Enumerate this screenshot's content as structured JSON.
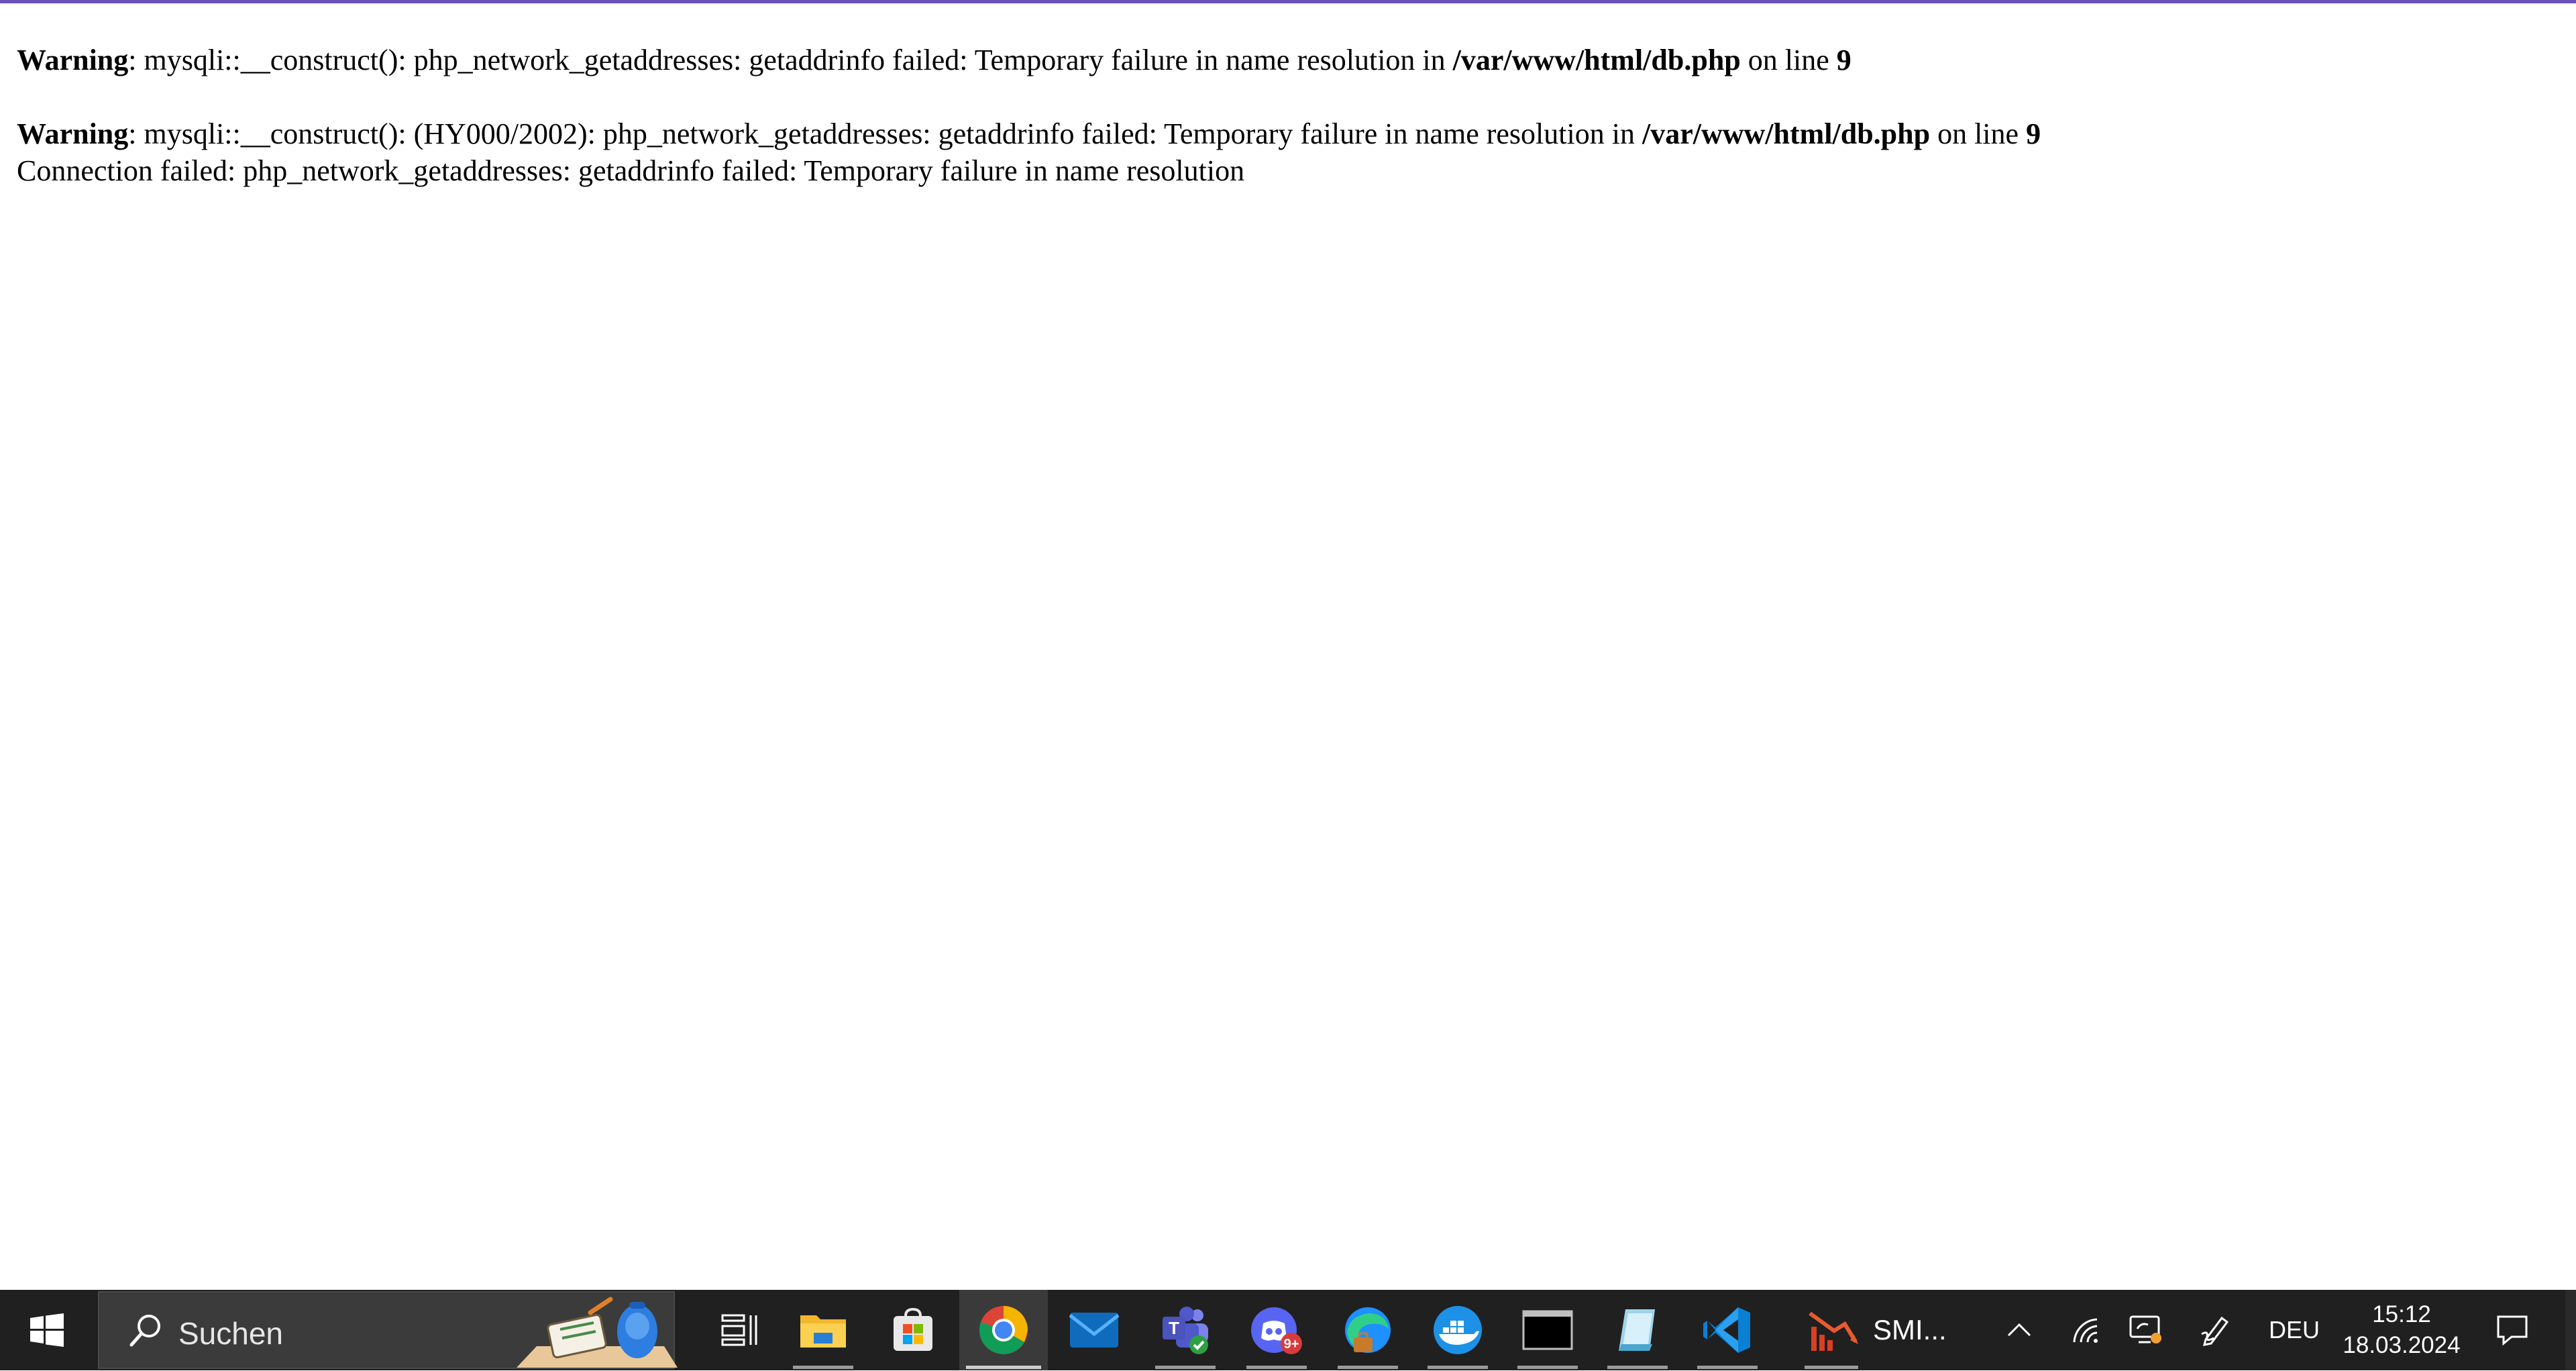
{
  "page": {
    "line1": {
      "label": "Warning",
      "message": ": mysqli::__construct(): php_network_getaddresses: getaddrinfo failed: Temporary failure in name resolution in ",
      "file": "/var/www/html/db.php",
      "on_line": " on line ",
      "line_number": "9"
    },
    "line2": {
      "label": "Warning",
      "message": ": mysqli::__construct(): (HY000/2002): php_network_getaddresses: getaddrinfo failed: Temporary failure in name resolution in ",
      "file": "/var/www/html/db.php",
      "on_line": " on line ",
      "line_number": "9"
    },
    "connection_error": "Connection failed: php_network_getaddresses: getaddrinfo failed: Temporary failure in name resolution"
  },
  "taskbar": {
    "search_placeholder": "Suchen",
    "apps": [
      {
        "name": "task-view-icon"
      },
      {
        "name": "file-explorer-icon"
      },
      {
        "name": "microsoft-store-icon"
      },
      {
        "name": "chrome-icon"
      },
      {
        "name": "mail-icon"
      },
      {
        "name": "teams-icon"
      },
      {
        "name": "discord-icon",
        "badge": "9+"
      },
      {
        "name": "edge-icon"
      },
      {
        "name": "docker-icon"
      },
      {
        "name": "terminal-icon"
      },
      {
        "name": "notes-icon"
      },
      {
        "name": "vscode-icon"
      },
      {
        "name": "smi-app-icon",
        "label": "SMI..."
      }
    ],
    "tray": {
      "language": "DEU",
      "time": "15:12",
      "date": "18.03.2024"
    }
  },
  "colors": {
    "top_accent": "#6b4fbb",
    "taskbar_bg": "#202020",
    "chrome_active_bg": "#3a3a3a"
  }
}
